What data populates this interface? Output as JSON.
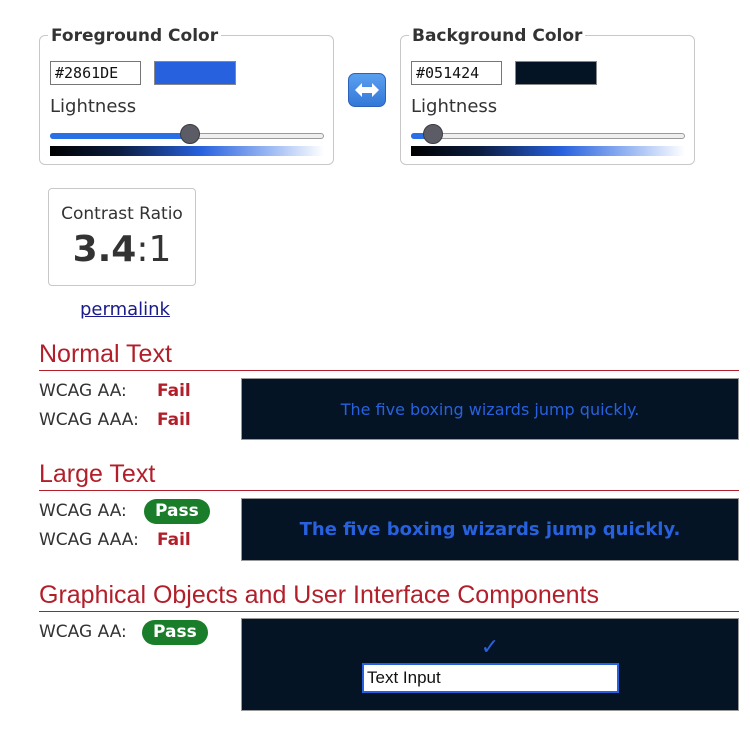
{
  "colors": {
    "foreground": "#2861DE",
    "background": "#051424",
    "accent_red": "#b21f2a",
    "pass_green": "#1a7d2a"
  },
  "foreground_picker": {
    "title": "Foreground Color",
    "hex_value": "#2861DE",
    "lightness_label": "Lightness",
    "lightness_fraction": 0.51
  },
  "background_picker": {
    "title": "Background Color",
    "hex_value": "#051424",
    "lightness_label": "Lightness",
    "lightness_fraction": 0.08
  },
  "swap_icon": "left-right-arrow-icon",
  "contrast": {
    "label": "Contrast Ratio",
    "ratio_bold": "3.4",
    "ratio_suffix": ":1"
  },
  "permalink_label": "permalink",
  "normal_text": {
    "title": "Normal Text",
    "aa_label": "WCAG AA:",
    "aa_result": "Fail",
    "aaa_label": "WCAG AAA:",
    "aaa_result": "Fail",
    "sample": "The five boxing wizards jump quickly."
  },
  "large_text": {
    "title": "Large Text",
    "aa_label": "WCAG AA:",
    "aa_result": "Pass",
    "aaa_label": "WCAG AAA:",
    "aaa_result": "Fail",
    "sample": "The five boxing wizards jump quickly."
  },
  "graphical": {
    "title": "Graphical Objects and User Interface Components",
    "aa_label": "WCAG AA:",
    "aa_result": "Pass",
    "checkmark": "✓",
    "input_value": "Text Input"
  }
}
